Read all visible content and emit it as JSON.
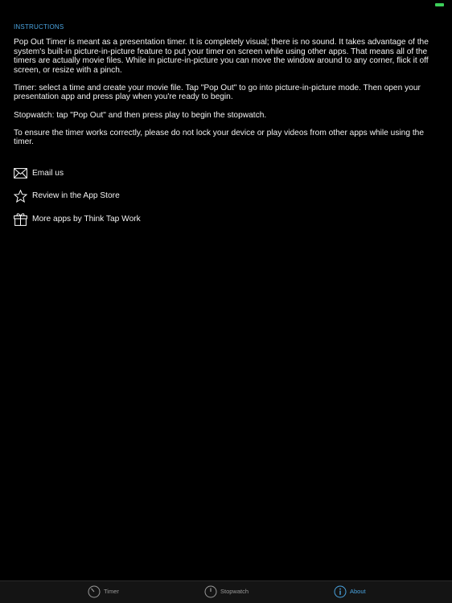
{
  "status_bar": {
    "battery_color": "#3ccf5a"
  },
  "header": {
    "section_title": "INSTRUCTIONS"
  },
  "instructions": {
    "paragraphs": [
      "Pop Out Timer is meant as a presentation timer. It is completely visual; there is no sound. It takes advantage of the system's built-in picture-in-picture feature to put your timer on screen while using other apps. That means all of the timers are actually movie files. While in picture-in-picture you can move the window around to any corner, flick it off screen, or resize with a pinch.",
      "Timer: select a time and create your movie file. Tap \"Pop Out\" to go into picture-in-picture mode. Then open your presentation app and press play when you're ready to begin.",
      "Stopwatch: tap \"Pop Out\" and then press play to begin the stopwatch.",
      "To ensure the timer works correctly, please do not lock your device or play videos from other apps while using the timer."
    ]
  },
  "links": [
    {
      "label": "Email us",
      "icon": "envelope-icon"
    },
    {
      "label": "Review in the App Store",
      "icon": "star-icon"
    },
    {
      "label": "More apps by Think Tap Work",
      "icon": "gift-icon"
    }
  ],
  "tabbar": {
    "tabs": [
      {
        "label": "Timer",
        "icon": "timer-icon",
        "active": false
      },
      {
        "label": "Stopwatch",
        "icon": "stopwatch-icon",
        "active": false
      },
      {
        "label": "About",
        "icon": "info-icon",
        "active": true
      }
    ]
  },
  "colors": {
    "accent": "#4aa3df",
    "background": "#000000",
    "tabbar": "#141414"
  }
}
